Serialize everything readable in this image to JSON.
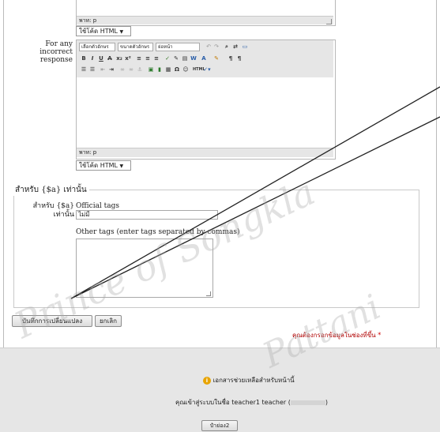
{
  "editor1": {
    "path": "พาท: p",
    "html_mode": "ใช้โค้ด HTML"
  },
  "incorrect_field": {
    "label": "For any incorrect response",
    "toolbar": {
      "font_family": "เลือกตัวอักษร",
      "font_size": "ขนาดตัวอักษร",
      "paragraph": "ย่อหน้า"
    },
    "path": "พาท: p",
    "html_mode": "ใช้โค้ด HTML"
  },
  "tags_section": {
    "legend": "สำหรับ {$a} เท่านั้น",
    "official_label": "สำหรับ {$a} เท่านั้น",
    "official_tags_title": "Official tags",
    "official_tags_value": "ไม่มี",
    "other_tags_label": "Other tags (enter tags separated by commas)"
  },
  "buttons": {
    "save": "บันทึกการเปลี่ยนแปลง",
    "cancel": "ยกเลิก"
  },
  "required_note": "คุณต้องกรอกข้อมูลในช่องที่ขึ้น",
  "required_star": "*",
  "footer": {
    "help_link": "เอกสารช่วยเหลือสำหรับหน้านี้",
    "login_text": "คุณเข้าสู่ระบบในชื่อ teacher1 teacher (",
    "login_close": ")",
    "course_link": "ปำย่อง2"
  },
  "watermark": {
    "line1": "Prince of Songkla",
    "line2": "Pattani"
  },
  "colors": {
    "required": "#b00000",
    "help_icon": "#e8a400",
    "footer_bg": "#e6e6e6"
  }
}
